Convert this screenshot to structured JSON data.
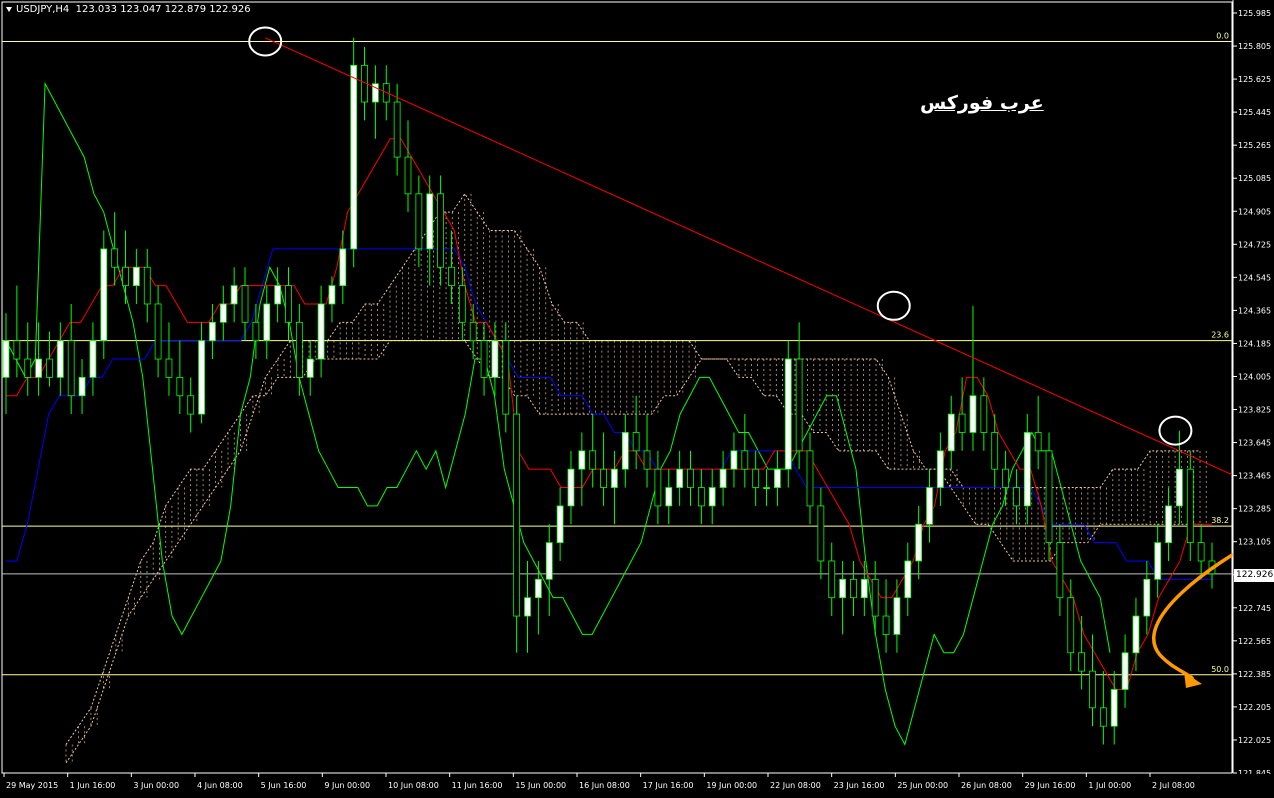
{
  "header": {
    "symbol": "USDJPY,H4",
    "quotes": "123.033 123.047 122.879 122.926"
  },
  "watermark": "عرب فوركس",
  "current_price": "122.926",
  "colors": {
    "background": "#000000",
    "bull_candle": "#ffffff",
    "bear_candle": "#000000",
    "candle_wick": "#00ff00",
    "tenkan": "#ff0000",
    "kijun": "#0000ff",
    "chikou": "#00ff00",
    "cloud": "#f4c59a",
    "trendline": "#ff0000",
    "fibo": "#ffff99",
    "projection": "#ff9900"
  },
  "chart_data": {
    "type": "candlestick",
    "symbol": "USDJPY",
    "timeframe": "H4",
    "ylim": [
      121.845,
      125.985
    ],
    "y_ticks": [
      "125.985",
      "125.805",
      "125.625",
      "125.445",
      "125.265",
      "125.085",
      "124.905",
      "124.725",
      "124.545",
      "124.365",
      "124.185",
      "124.005",
      "123.825",
      "123.645",
      "123.465",
      "123.285",
      "123.105",
      "122.925",
      "122.745",
      "122.565",
      "122.385",
      "122.205",
      "122.025",
      "121.845"
    ],
    "x_ticks": [
      "29 May 2015",
      "1 Jun 16:00",
      "3 Jun 00:00",
      "4 Jun 08:00",
      "5 Jun 16:00",
      "9 Jun 00:00",
      "10 Jun 08:00",
      "11 Jun 16:00",
      "15 Jun 00:00",
      "16 Jun 08:00",
      "17 Jun 16:00",
      "19 Jun 00:00",
      "22 Jun 08:00",
      "23 Jun 16:00",
      "25 Jun 00:00",
      "26 Jun 08:00",
      "29 Jun 16:00",
      "1 Jul 00:00",
      "2 Jul 08:00"
    ],
    "fibonacci_levels": [
      {
        "label": "0.0",
        "price": 125.83
      },
      {
        "label": "23.6",
        "price": 124.2
      },
      {
        "label": "38.2",
        "price": 123.19
      },
      {
        "label": "50.0",
        "price": 122.38
      }
    ],
    "horizontal_line": {
      "price": 122.93
    },
    "trendline": {
      "start": {
        "x": 0.214,
        "price": 125.85
      },
      "end": {
        "x": 1.0,
        "price": 123.47
      }
    },
    "circled_highs": [
      {
        "x": 0.214,
        "price": 125.83
      },
      {
        "x": 0.725,
        "price": 124.39
      },
      {
        "x": 0.954,
        "price": 123.71
      }
    ],
    "candles_ohlc": [
      [
        124.0,
        124.35,
        123.8,
        124.2
      ],
      [
        124.2,
        124.5,
        124.0,
        124.1
      ],
      [
        124.1,
        124.3,
        123.9,
        124.0
      ],
      [
        124.0,
        124.3,
        123.9,
        124.1
      ],
      [
        124.1,
        124.25,
        123.95,
        124.0
      ],
      [
        124.0,
        124.3,
        123.9,
        124.2
      ],
      [
        124.2,
        124.4,
        123.8,
        123.9
      ],
      [
        123.9,
        124.1,
        123.8,
        124.0
      ],
      [
        124.0,
        124.3,
        123.9,
        124.2
      ],
      [
        124.2,
        124.8,
        124.1,
        124.7
      ],
      [
        124.7,
        124.9,
        124.5,
        124.6
      ],
      [
        124.6,
        124.8,
        124.4,
        124.5
      ],
      [
        124.5,
        124.7,
        124.4,
        124.6
      ],
      [
        124.6,
        124.7,
        124.3,
        124.4
      ],
      [
        124.4,
        124.5,
        124.0,
        124.1
      ],
      [
        124.1,
        124.3,
        123.9,
        124.0
      ],
      [
        124.0,
        124.2,
        123.8,
        123.9
      ],
      [
        123.9,
        124.0,
        123.7,
        123.8
      ],
      [
        123.8,
        124.3,
        123.75,
        124.2
      ],
      [
        124.2,
        124.4,
        124.1,
        124.3
      ],
      [
        124.3,
        124.5,
        124.2,
        124.4
      ],
      [
        124.4,
        124.6,
        124.3,
        124.5
      ],
      [
        124.5,
        124.6,
        124.2,
        124.3
      ],
      [
        124.3,
        124.4,
        124.1,
        124.2
      ],
      [
        124.2,
        124.5,
        124.1,
        124.4
      ],
      [
        124.4,
        124.6,
        124.3,
        124.5
      ],
      [
        124.5,
        124.6,
        124.2,
        124.3
      ],
      [
        124.3,
        124.4,
        123.9,
        124.0
      ],
      [
        124.0,
        124.2,
        123.9,
        124.1
      ],
      [
        124.1,
        124.5,
        124.0,
        124.4
      ],
      [
        124.4,
        124.55,
        124.3,
        124.5
      ],
      [
        124.5,
        124.8,
        124.4,
        124.7
      ],
      [
        124.7,
        125.85,
        124.6,
        125.7
      ],
      [
        125.7,
        125.8,
        125.4,
        125.5
      ],
      [
        125.5,
        125.7,
        125.3,
        125.6
      ],
      [
        125.6,
        125.7,
        125.4,
        125.5
      ],
      [
        125.5,
        125.6,
        125.1,
        125.2
      ],
      [
        125.2,
        125.4,
        124.9,
        125.0
      ],
      [
        125.0,
        125.1,
        124.6,
        124.7
      ],
      [
        124.7,
        125.1,
        124.5,
        125.0
      ],
      [
        125.0,
        125.1,
        124.5,
        124.6
      ],
      [
        124.6,
        124.8,
        124.4,
        124.5
      ],
      [
        124.5,
        124.6,
        124.2,
        124.3
      ],
      [
        124.3,
        124.4,
        124.1,
        124.2
      ],
      [
        124.2,
        124.3,
        123.9,
        124.0
      ],
      [
        124.0,
        124.3,
        123.9,
        124.2
      ],
      [
        124.2,
        124.3,
        123.7,
        123.8
      ],
      [
        123.8,
        123.9,
        122.5,
        122.7
      ],
      [
        122.7,
        123.0,
        122.5,
        122.8
      ],
      [
        122.8,
        123.0,
        122.6,
        122.9
      ],
      [
        122.9,
        123.2,
        122.7,
        123.1
      ],
      [
        123.1,
        123.4,
        123.0,
        123.3
      ],
      [
        123.3,
        123.6,
        123.2,
        123.5
      ],
      [
        123.5,
        123.7,
        123.3,
        123.6
      ],
      [
        123.6,
        123.8,
        123.4,
        123.5
      ],
      [
        123.5,
        123.7,
        123.3,
        123.4
      ],
      [
        123.4,
        123.6,
        123.2,
        123.5
      ],
      [
        123.5,
        123.8,
        123.4,
        123.7
      ],
      [
        123.7,
        123.9,
        123.5,
        123.6
      ],
      [
        123.6,
        123.8,
        123.4,
        123.5
      ],
      [
        123.5,
        123.6,
        123.2,
        123.3
      ],
      [
        123.3,
        123.5,
        123.2,
        123.4
      ],
      [
        123.4,
        123.6,
        123.3,
        123.5
      ],
      [
        123.5,
        123.6,
        123.3,
        123.4
      ],
      [
        123.4,
        123.5,
        123.2,
        123.3
      ],
      [
        123.3,
        123.5,
        123.2,
        123.4
      ],
      [
        123.4,
        123.6,
        123.3,
        123.5
      ],
      [
        123.5,
        123.7,
        123.4,
        123.6
      ],
      [
        123.6,
        123.8,
        123.4,
        123.5
      ],
      [
        123.5,
        123.6,
        123.3,
        123.4
      ],
      [
        123.4,
        123.5,
        123.3,
        123.4
      ],
      [
        123.4,
        123.6,
        123.3,
        123.5
      ],
      [
        123.5,
        124.2,
        123.4,
        124.1
      ],
      [
        124.1,
        124.3,
        123.5,
        123.6
      ],
      [
        123.6,
        123.7,
        123.2,
        123.3
      ],
      [
        123.3,
        123.4,
        122.9,
        123.0
      ],
      [
        123.0,
        123.1,
        122.7,
        122.8
      ],
      [
        122.8,
        123.0,
        122.6,
        122.9
      ],
      [
        122.9,
        123.0,
        122.7,
        122.8
      ],
      [
        122.8,
        123.0,
        122.7,
        122.9
      ],
      [
        122.9,
        123.0,
        122.6,
        122.7
      ],
      [
        122.7,
        122.9,
        122.5,
        122.6
      ],
      [
        122.6,
        122.9,
        122.5,
        122.8
      ],
      [
        122.8,
        123.1,
        122.7,
        123.0
      ],
      [
        123.0,
        123.3,
        122.9,
        123.2
      ],
      [
        123.2,
        123.5,
        123.1,
        123.4
      ],
      [
        123.4,
        123.7,
        123.3,
        123.6
      ],
      [
        123.6,
        123.9,
        123.5,
        123.8
      ],
      [
        123.8,
        124.0,
        123.6,
        123.7
      ],
      [
        123.7,
        124.39,
        123.6,
        123.9
      ],
      [
        123.9,
        124.0,
        123.6,
        123.7
      ],
      [
        123.7,
        123.8,
        123.4,
        123.5
      ],
      [
        123.5,
        123.6,
        123.3,
        123.4
      ],
      [
        123.4,
        123.5,
        123.2,
        123.3
      ],
      [
        123.3,
        123.8,
        123.2,
        123.7
      ],
      [
        123.7,
        123.9,
        123.5,
        123.6
      ],
      [
        123.6,
        123.7,
        123.0,
        123.1
      ],
      [
        123.1,
        123.2,
        122.7,
        122.8
      ],
      [
        122.8,
        122.9,
        122.4,
        122.5
      ],
      [
        122.5,
        122.7,
        122.3,
        122.4
      ],
      [
        122.4,
        122.6,
        122.1,
        122.2
      ],
      [
        122.2,
        122.4,
        122.0,
        122.1
      ],
      [
        122.1,
        122.4,
        122.0,
        122.3
      ],
      [
        122.3,
        122.6,
        122.2,
        122.5
      ],
      [
        122.5,
        122.8,
        122.4,
        122.7
      ],
      [
        122.7,
        123.0,
        122.6,
        122.9
      ],
      [
        122.9,
        123.2,
        122.8,
        123.1
      ],
      [
        123.1,
        123.4,
        123.0,
        123.3
      ],
      [
        123.3,
        123.71,
        123.2,
        123.5
      ],
      [
        123.5,
        123.6,
        123.0,
        123.1
      ],
      [
        123.1,
        123.2,
        122.9,
        123.0
      ],
      [
        123.0,
        123.1,
        122.85,
        122.93
      ]
    ],
    "indicators": {
      "tenkan_sen": [
        123.9,
        123.9,
        124.0,
        124.0,
        124.1,
        124.2,
        124.3,
        124.3,
        124.4,
        124.5,
        124.5,
        124.6,
        124.6,
        124.6,
        124.5,
        124.5,
        124.4,
        124.3,
        124.3,
        124.3,
        124.4,
        124.4,
        124.5,
        124.5,
        124.5,
        124.5,
        124.5,
        124.5,
        124.4,
        124.4,
        124.4,
        124.6,
        124.9,
        125.0,
        125.1,
        125.2,
        125.3,
        125.3,
        125.2,
        125.1,
        125.0,
        124.9,
        124.8,
        124.5,
        124.3,
        124.3,
        124.2,
        124.1,
        123.6,
        123.5,
        123.5,
        123.5,
        123.4,
        123.4,
        123.4,
        123.5,
        123.5,
        123.5,
        123.6,
        123.6,
        123.5,
        123.5,
        123.5,
        123.5,
        123.5,
        123.5,
        123.5,
        123.5,
        123.5,
        123.5,
        123.5,
        123.5,
        123.6,
        123.6,
        123.6,
        123.6,
        123.5,
        123.4,
        123.3,
        123.2,
        123.0,
        122.9,
        122.8,
        122.8,
        122.9,
        123.0,
        123.2,
        123.3,
        123.6,
        123.7,
        124.0,
        124.0,
        123.9,
        123.7,
        123.6,
        123.5,
        123.5,
        123.3,
        123.0,
        122.9,
        122.8,
        122.6,
        122.5,
        122.4,
        122.3,
        122.3,
        122.5,
        122.6,
        122.8,
        122.9,
        123.0,
        123.2,
        123.2,
        123.2
      ],
      "kijun_sen": [
        123.0,
        123.0,
        123.2,
        123.5,
        123.8,
        123.9,
        123.9,
        123.9,
        124.0,
        124.0,
        124.1,
        124.1,
        124.1,
        124.1,
        124.2,
        124.2,
        124.2,
        124.2,
        124.2,
        124.2,
        124.2,
        124.2,
        124.2,
        124.3,
        124.5,
        124.7,
        124.7,
        124.7,
        124.7,
        124.7,
        124.7,
        124.7,
        124.7,
        124.7,
        124.7,
        124.7,
        124.7,
        124.7,
        124.7,
        124.7,
        124.7,
        124.7,
        124.7,
        124.6,
        124.4,
        124.3,
        124.2,
        124.1,
        124.0,
        124.0,
        124.0,
        124.0,
        123.9,
        123.9,
        123.9,
        123.8,
        123.8,
        123.7,
        123.7,
        123.6,
        123.6,
        123.5,
        123.5,
        123.5,
        123.5,
        123.5,
        123.5,
        123.5,
        123.6,
        123.6,
        123.6,
        123.6,
        123.6,
        123.6,
        123.5,
        123.4,
        123.4,
        123.4,
        123.4,
        123.4,
        123.4,
        123.4,
        123.4,
        123.4,
        123.4,
        123.4,
        123.4,
        123.4,
        123.4,
        123.4,
        123.4,
        123.4,
        123.4,
        123.4,
        123.4,
        123.4,
        123.4,
        123.3,
        123.2,
        123.2,
        123.2,
        123.2,
        123.1,
        123.1,
        123.1,
        123.0,
        123.0,
        123.0,
        122.9,
        122.9,
        122.9,
        122.9,
        122.9,
        122.9
      ],
      "chikou_span": [
        124.2,
        124.1,
        124.0,
        124.1,
        125.6,
        125.5,
        125.4,
        125.3,
        125.2,
        125.0,
        124.9,
        124.7,
        124.5,
        124.3,
        124.0,
        123.5,
        123.0,
        122.7,
        122.6,
        122.7,
        122.8,
        122.9,
        123.0,
        123.3,
        123.8,
        124.0,
        124.4,
        124.6,
        124.5,
        124.3,
        124.0,
        123.8,
        123.6,
        123.5,
        123.4,
        123.4,
        123.4,
        123.3,
        123.3,
        123.4,
        123.4,
        123.5,
        123.6,
        123.5,
        123.6,
        123.4,
        123.6,
        123.8,
        124.1,
        124.1,
        123.9,
        123.5,
        123.3,
        123.1,
        123.0,
        122.9,
        122.8,
        122.8,
        122.7,
        122.6,
        122.6,
        122.7,
        122.8,
        122.9,
        123.0,
        123.1,
        123.3,
        123.5,
        123.6,
        123.8,
        123.9,
        124.0,
        124.0,
        123.9,
        123.8,
        123.7,
        123.7,
        123.6,
        123.5,
        123.5,
        123.5,
        123.6,
        123.7,
        123.8,
        123.9,
        123.9,
        123.7,
        123.5,
        123.0,
        122.6,
        122.3,
        122.1,
        122.0,
        122.2,
        122.4,
        122.6,
        122.5,
        122.5,
        122.6,
        122.8,
        123.0,
        123.2,
        123.3,
        123.5,
        123.6,
        123.7,
        123.6,
        123.6,
        123.4,
        123.2,
        123.0,
        122.9,
        122.8,
        122.5
      ],
      "senkou_a": [
        121.9,
        122.0,
        122.1,
        122.3,
        122.5,
        122.7,
        122.8,
        122.9,
        123.0,
        123.1,
        123.2,
        123.3,
        123.4,
        123.5,
        123.6,
        123.8,
        124.0,
        124.1,
        124.2,
        124.2,
        124.2,
        124.2,
        124.3,
        124.3,
        124.4,
        124.4,
        124.5,
        124.6,
        124.7,
        124.8,
        124.9,
        124.9,
        125.0,
        124.9,
        124.8,
        124.8,
        124.8,
        124.7,
        124.6,
        124.4,
        124.3,
        124.3,
        124.2,
        124.2,
        124.2,
        124.2,
        124.2,
        124.2,
        124.2,
        124.2,
        124.2,
        124.1,
        124.1,
        124.1,
        124.0,
        124.0,
        123.9,
        123.9,
        123.8,
        123.8,
        123.7,
        123.7,
        123.6,
        123.6,
        123.6,
        123.6,
        123.5,
        123.5,
        123.5,
        123.5,
        123.5,
        123.5,
        123.4,
        123.4,
        123.4,
        123.4,
        123.4,
        123.4,
        123.4,
        123.4,
        123.4,
        123.4,
        123.4,
        123.4,
        123.5,
        123.5,
        123.5,
        123.6,
        123.6,
        123.6,
        123.6,
        123.6
      ],
      "senkou_b": [
        122.0,
        122.1,
        122.2,
        122.4,
        122.6,
        122.8,
        123.0,
        123.1,
        123.3,
        123.4,
        123.5,
        123.5,
        123.6,
        123.7,
        123.8,
        123.9,
        123.9,
        124.0,
        124.0,
        124.0,
        124.1,
        124.1,
        124.1,
        124.1,
        124.1,
        124.1,
        124.2,
        124.2,
        124.2,
        124.2,
        124.2,
        124.2,
        124.2,
        124.1,
        124.0,
        124.0,
        123.9,
        123.9,
        123.8,
        123.8,
        123.8,
        123.8,
        123.8,
        123.8,
        123.8,
        123.8,
        123.8,
        123.8,
        123.9,
        123.9,
        124.0,
        124.1,
        124.1,
        124.1,
        124.1,
        124.1,
        124.1,
        124.1,
        124.1,
        124.1,
        124.1,
        124.1,
        124.1,
        124.1,
        124.1,
        124.1,
        124.0,
        123.8,
        123.6,
        123.5,
        123.5,
        123.4,
        123.3,
        123.2,
        123.2,
        123.1,
        123.0,
        123.0,
        123.0,
        123.0,
        123.1,
        123.1,
        123.1,
        123.2,
        123.2,
        123.2,
        123.2,
        123.2,
        123.2,
        123.2,
        123.2,
        123.2
      ]
    }
  }
}
